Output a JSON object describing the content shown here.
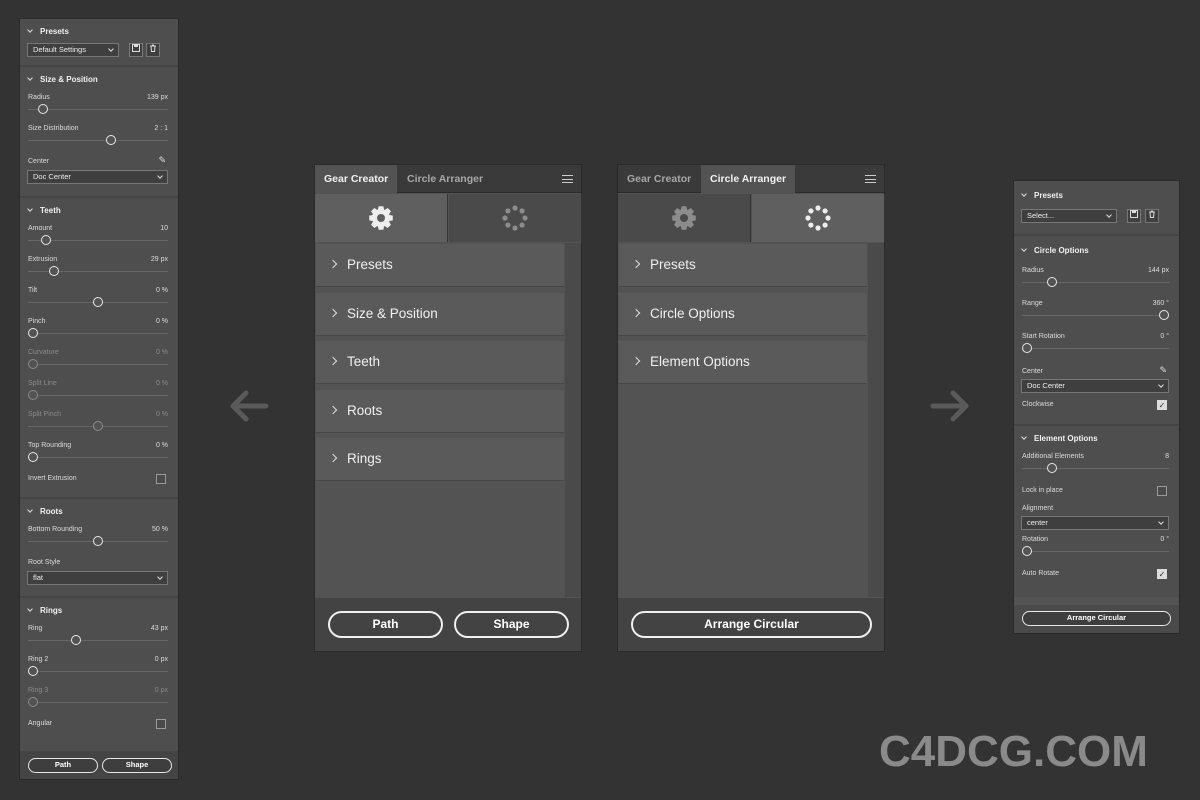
{
  "left_panel": {
    "presets": {
      "title": "Presets",
      "select": "Default Settings"
    },
    "size_position": {
      "title": "Size & Position",
      "radius": {
        "label": "Radius",
        "value": "139 px",
        "level": 0.08
      },
      "size_distribution": {
        "label": "Size Distribution",
        "value": "2 : 1",
        "level": 0.6
      },
      "center": {
        "label": "Center",
        "select": "Doc Center"
      }
    },
    "teeth": {
      "title": "Teeth",
      "controls": [
        {
          "label": "Amount",
          "value": "10",
          "level": 0.1,
          "dim": false
        },
        {
          "label": "Extrusion",
          "value": "29 px",
          "level": 0.16,
          "dim": false
        },
        {
          "label": "Tilt",
          "value": "0 %",
          "level": 0.5,
          "dim": false
        },
        {
          "label": "Pinch",
          "value": "0 %",
          "level": 0.0,
          "dim": false
        },
        {
          "label": "Curvature",
          "value": "0 %",
          "level": 0.0,
          "dim": true
        },
        {
          "label": "Split Line",
          "value": "0 %",
          "level": 0.0,
          "dim": true
        },
        {
          "label": "Split Pinch",
          "value": "0 %",
          "level": 0.5,
          "dim": true
        },
        {
          "label": "Top Rounding",
          "value": "0 %",
          "level": 0.0,
          "dim": false
        }
      ],
      "invert_extrusion": "Invert Extrusion"
    },
    "roots": {
      "title": "Roots",
      "bottom_rounding": {
        "label": "Bottom Rounding",
        "value": "50 %",
        "level": 0.5
      },
      "root_style": {
        "label": "Root Style",
        "select": "flat"
      }
    },
    "rings": {
      "title": "Rings",
      "controls": [
        {
          "label": "Ring",
          "value": "43 px",
          "level": 0.33,
          "dim": false
        },
        {
          "label": "Ring 2",
          "value": "0 px",
          "level": 0.0,
          "dim": false
        },
        {
          "label": "Ring 3",
          "value": "0 px",
          "level": 0.0,
          "dim": true
        }
      ],
      "angular": "Angular"
    },
    "buttons": {
      "path": "Path",
      "shape": "Shape"
    }
  },
  "gear_panel": {
    "tabs": [
      "Gear Creator",
      "Circle Arranger"
    ],
    "sections": [
      "Presets",
      "Size & Position",
      "Teeth",
      "Roots",
      "Rings"
    ],
    "buttons": {
      "path": "Path",
      "shape": "Shape"
    }
  },
  "circle_panel": {
    "tabs": [
      "Gear Creator",
      "Circle Arranger"
    ],
    "sections": [
      "Presets",
      "Circle Options",
      "Element Options"
    ],
    "button": "Arrange Circular"
  },
  "right_panel": {
    "presets": {
      "title": "Presets",
      "select": "Select..."
    },
    "circle_options": {
      "title": "Circle Options",
      "radius": {
        "label": "Radius",
        "value": "144 px",
        "level": 0.18
      },
      "range": {
        "label": "Range",
        "value": "360 °",
        "level": 1.0
      },
      "start_rotation": {
        "label": "Start Rotation",
        "value": "0 °",
        "level": 0.0
      },
      "center": {
        "label": "Center",
        "select": "Doc Center"
      },
      "clockwise": "Clockwise"
    },
    "element_options": {
      "title": "Element Options",
      "additional_elements": {
        "label": "Additional Elements",
        "value": "8",
        "level": 0.18
      },
      "lock_in_place": "Lock in place",
      "alignment": {
        "label": "Alignment",
        "select": "center"
      },
      "rotation": {
        "label": "Rotation",
        "value": "0 °",
        "level": 0.0
      },
      "auto_rotate": "Auto Rotate"
    },
    "button": "Arrange Circular"
  },
  "watermark": "C4DCG.COM",
  "icons": {
    "gear": "gear-icon",
    "dots": "circle-dots-icon",
    "menu": "menu-icon",
    "arrow_left": "arrow-left-icon",
    "arrow_right": "arrow-right-icon",
    "check": "✓",
    "save": "save-icon",
    "trash": "trash-icon",
    "pen": "eyedropper-icon"
  }
}
